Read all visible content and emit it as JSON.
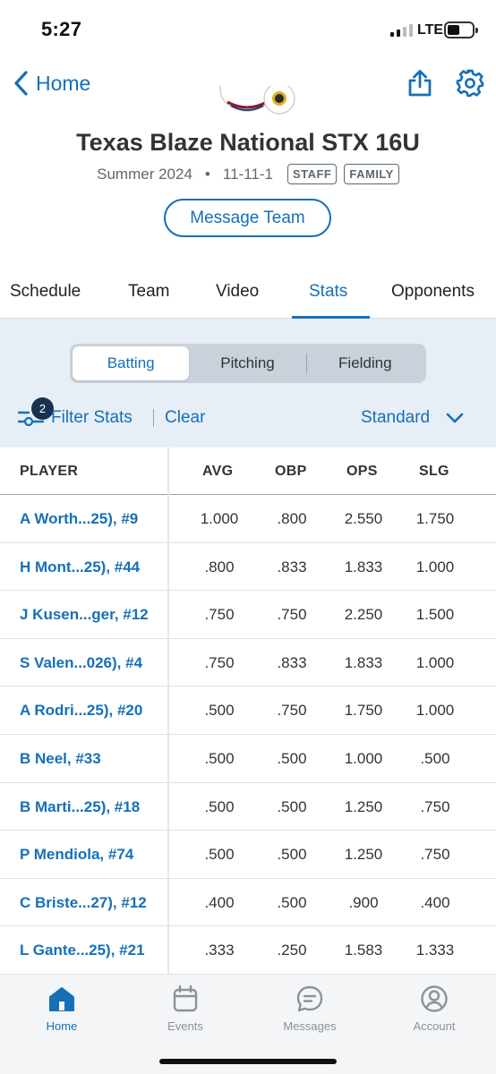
{
  "status_bar": {
    "time": "5:27",
    "network": "LTE"
  },
  "header": {
    "back_label": "Home"
  },
  "team": {
    "name": "Texas Blaze National STX 16U",
    "season": "Summer 2024",
    "record": "11-11-1",
    "badges": [
      "STAFF",
      "FAMILY"
    ],
    "message_button": "Message Team"
  },
  "tabs": [
    {
      "label": "Schedule",
      "active": false
    },
    {
      "label": "Team",
      "active": false
    },
    {
      "label": "Video",
      "active": false
    },
    {
      "label": "Stats",
      "active": true
    },
    {
      "label": "Opponents",
      "active": false
    }
  ],
  "stats": {
    "segments": [
      {
        "label": "Batting",
        "active": true
      },
      {
        "label": "Pitching",
        "active": false
      },
      {
        "label": "Fielding",
        "active": false
      }
    ],
    "filter_count": "2",
    "filter_label": "Filter Stats",
    "clear_label": "Clear",
    "stat_set": "Standard"
  },
  "table": {
    "columns": [
      "PLAYER",
      "AVG",
      "OBP",
      "OPS",
      "SLG"
    ],
    "rows": [
      {
        "player": "A Worth...25), #9",
        "avg": "1.000",
        "obp": ".800",
        "ops": "2.550",
        "slg": "1.750"
      },
      {
        "player": "H Mont...25), #44",
        "avg": ".800",
        "obp": ".833",
        "ops": "1.833",
        "slg": "1.000"
      },
      {
        "player": "J Kusen...ger, #12",
        "avg": ".750",
        "obp": ".750",
        "ops": "2.250",
        "slg": "1.500"
      },
      {
        "player": "S Valen...026), #4",
        "avg": ".750",
        "obp": ".833",
        "ops": "1.833",
        "slg": "1.000"
      },
      {
        "player": "A Rodri...25), #20",
        "avg": ".500",
        "obp": ".750",
        "ops": "1.750",
        "slg": "1.000"
      },
      {
        "player": "B Neel, #33",
        "avg": ".500",
        "obp": ".500",
        "ops": "1.000",
        "slg": ".500"
      },
      {
        "player": "B Marti...25), #18",
        "avg": ".500",
        "obp": ".500",
        "ops": "1.250",
        "slg": ".750"
      },
      {
        "player": "P Mendiola, #74",
        "avg": ".500",
        "obp": ".500",
        "ops": "1.250",
        "slg": ".750"
      },
      {
        "player": "C Briste...27), #12",
        "avg": ".400",
        "obp": ".500",
        "ops": ".900",
        "slg": ".400"
      },
      {
        "player": "L Gante...25), #21",
        "avg": ".333",
        "obp": ".250",
        "ops": "1.583",
        "slg": "1.333"
      }
    ]
  },
  "bottom_nav": [
    {
      "label": "Home",
      "icon": "home-icon",
      "active": true
    },
    {
      "label": "Events",
      "icon": "calendar-icon",
      "active": false
    },
    {
      "label": "Messages",
      "icon": "message-icon",
      "active": false
    },
    {
      "label": "Account",
      "icon": "account-icon",
      "active": false
    }
  ],
  "colors": {
    "accent": "#1570b8",
    "stats_bg": "#e8eef6",
    "badge_dark": "#16324f"
  }
}
